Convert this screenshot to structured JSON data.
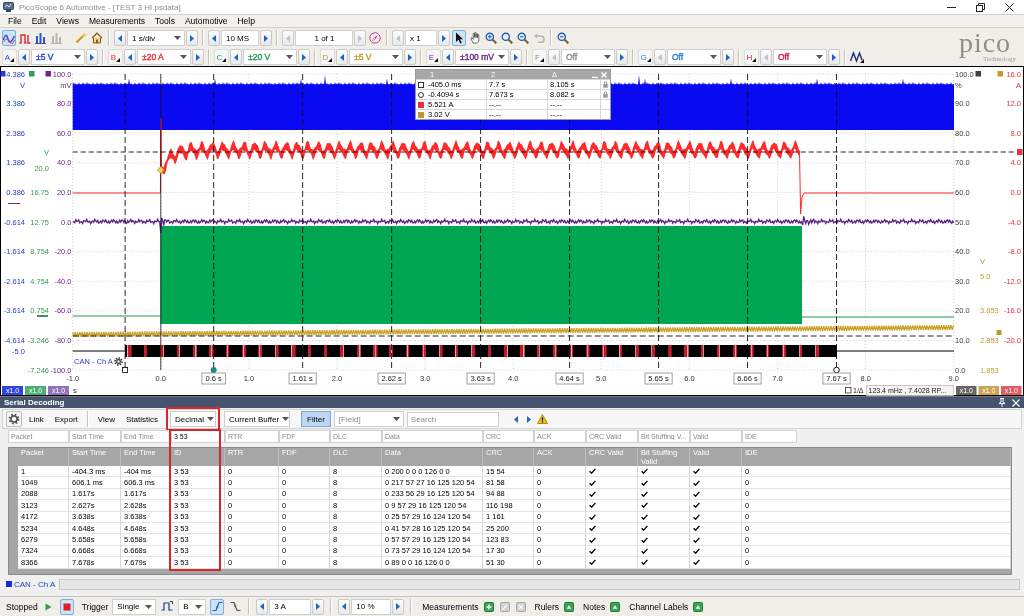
{
  "window": {
    "title": "PicoScope 6 Automotive - [TEST 3 HI.psdata]"
  },
  "menu": [
    "File",
    "Edit",
    "Views",
    "Measurements",
    "Tools",
    "Automotive",
    "Help"
  ],
  "toolbar": {
    "view_modes": [
      {
        "selected": true,
        "disabled": false
      },
      {
        "selected": false,
        "disabled": false
      },
      {
        "selected": false,
        "disabled": false
      },
      {
        "selected": false,
        "disabled": true
      }
    ],
    "timebase": {
      "value": "1 s/div",
      "prev_enabled": true,
      "next_enabled": true
    },
    "samples": {
      "value": "10 MS",
      "prev_enabled": true,
      "next_enabled": true
    },
    "buffer": {
      "value": "1 of 1",
      "prev_enabled": false,
      "next_enabled": false
    },
    "zoom": {
      "value": "x 1",
      "prev_enabled": false,
      "next_enabled": true
    },
    "tools": [
      {
        "selected": true,
        "disabled": false
      },
      {
        "selected": false,
        "disabled": false
      },
      {
        "selected": false,
        "disabled": false
      },
      {
        "selected": false,
        "disabled": false
      },
      {
        "selected": false,
        "disabled": false
      },
      {
        "selected": false,
        "disabled": true
      },
      {
        "selected": false,
        "disabled": false
      }
    ]
  },
  "channels": [
    {
      "letter": "A",
      "range": "±5 V",
      "color": "#2c44d8",
      "enabled": true
    },
    {
      "letter": "B",
      "range": "±20 A",
      "color": "#e8303a",
      "enabled": true
    },
    {
      "letter": "C",
      "range": "±20 V",
      "color": "#2a9a58",
      "enabled": true
    },
    {
      "letter": "D",
      "range": "±5 V",
      "color": "#c09a30",
      "enabled": true
    },
    {
      "letter": "E",
      "range": "±100 mV",
      "color": "#6a2a88",
      "enabled": true
    },
    {
      "letter": "F",
      "range": "Off",
      "color": "#8c8c8c",
      "enabled": false
    },
    {
      "letter": "G",
      "range": "Off",
      "color": "#2c7ee0",
      "enabled": false
    },
    {
      "letter": "H",
      "range": "Off",
      "color": "#c8204a",
      "enabled": false
    }
  ],
  "logo": {
    "name": "pico",
    "tagline": "Technology"
  },
  "scope": {
    "left_axes": [
      {
        "unit": "V",
        "color": "#2c3cd0",
        "ticks": [
          "4.386",
          "3.386",
          "2.386",
          "1.386",
          "0.386",
          "-0.614",
          "-1.614",
          "-2.614",
          "-3.614",
          "-4.614",
          "-5.0"
        ]
      },
      {
        "unit": "V",
        "color": "#3a9a5c",
        "ticks": [
          "20.0",
          "16.75",
          "12.75",
          "8.754",
          "4.754",
          "0.754",
          "-3.246",
          "-7.246"
        ]
      },
      {
        "unit": "mV",
        "color": "#6a2a88",
        "ticks": [
          "100.0",
          "80.0",
          "60.0",
          "40.0",
          "20.0",
          "0.0",
          "-20.0",
          "-40.0",
          "-60.0",
          "-80.0",
          "-100.0"
        ]
      }
    ],
    "right_axes": [
      {
        "unit": "%",
        "color": "#404040",
        "ticks": [
          "100.0",
          "90.0",
          "80.0",
          "70.0",
          "60.0",
          "50.0",
          "40.0",
          "30.0",
          "20.0",
          "10.0",
          "0.0"
        ]
      },
      {
        "unit": "A",
        "color": "#e8303a",
        "ticks": [
          "16.0",
          "12.0",
          "8.0",
          "4.0",
          "0.0",
          "-4.0",
          "-8.0",
          "-12.0",
          "-16.0",
          "-20.0"
        ]
      },
      {
        "unit": "V",
        "color": "#c09a30",
        "ticks": [
          "5.0",
          "3.853",
          "2.853",
          "1.853"
        ]
      }
    ],
    "x_ticks": [
      "-1.0",
      "0.0",
      "1.0",
      "2.0",
      "3.0",
      "4.0",
      "5.0",
      "6.0",
      "7.0",
      "8.0",
      "9.0"
    ],
    "time_unit": "s",
    "rulers": [
      "0.6 s",
      "1.61 s",
      "2.62 s",
      "3.63 s",
      "4.64 s",
      "5.65 s",
      "6.66 s",
      "7.67 s"
    ],
    "decoder_label": "CAN - Ch A",
    "cursor_table": {
      "headers": [
        "1",
        "2",
        "Δ"
      ],
      "rows": [
        {
          "kind": "square",
          "cells": [
            "-405.0 ms",
            "7.7 s",
            "8.105 s"
          ],
          "locked": true
        },
        {
          "kind": "circle",
          "cells": [
            "-0.4094 s",
            "7.673 s",
            "8.082 s"
          ],
          "locked": true
        },
        {
          "kind": "signal",
          "color": "#e8303a",
          "cells": [
            "5.521 A",
            "--.--",
            "--.--"
          ],
          "locked": false
        },
        {
          "kind": "signal",
          "color": "#c09a30",
          "cells": [
            "3.02 V",
            "--.--",
            "--.--"
          ],
          "locked": false
        }
      ]
    },
    "scale_buttons_left": [
      {
        "label": "x1.0",
        "color": "#3344e0"
      },
      {
        "label": "x1.0",
        "color": "#4fae78"
      },
      {
        "label": "x1.0",
        "color": "#9474b8"
      }
    ],
    "scale_buttons_right": [
      {
        "label": "x1.0",
        "color": "#666666"
      },
      {
        "label": "x1.0",
        "color": "#c9a554"
      },
      {
        "label": "x1.0",
        "color": "#e45a66"
      }
    ],
    "readout_toggle": "1/Δ",
    "readout": "123.4 mHz , 7.4028 RP..."
  },
  "serial_decoding": {
    "title": "Serial Decoding",
    "toolbar": {
      "link": "Link",
      "export": "Export",
      "view": "View",
      "statistics": "Statistics",
      "format": {
        "value": "Decimal",
        "highlighted": true
      },
      "buffer": "Current Buffer",
      "filter": {
        "label": "Filter",
        "selected": true
      },
      "field": "[Field]",
      "search": {
        "placeholder": "Search"
      }
    },
    "filters": [
      {
        "placeholder": "Packet"
      },
      {
        "placeholder": "Start Time"
      },
      {
        "placeholder": "End Time"
      },
      {
        "value": "3 53"
      },
      {
        "placeholder": "RTR"
      },
      {
        "placeholder": "FDF"
      },
      {
        "placeholder": "DLC"
      },
      {
        "placeholder": "Data"
      },
      {
        "placeholder": "CRC"
      },
      {
        "placeholder": "ACK"
      },
      {
        "placeholder": "CRC Valid"
      },
      {
        "placeholder": "Bit Stuffing V..."
      },
      {
        "placeholder": "Valid"
      },
      {
        "placeholder": "IDE"
      }
    ],
    "columns": [
      {
        "label": "Packet",
        "kind": "text",
        "highlighted": false
      },
      {
        "label": "Start Time",
        "kind": "text",
        "highlighted": false
      },
      {
        "label": "End Time",
        "kind": "text",
        "highlighted": false
      },
      {
        "label": "ID",
        "kind": "text",
        "highlighted": true
      },
      {
        "label": "RTR",
        "kind": "text",
        "highlighted": false
      },
      {
        "label": "FDF",
        "kind": "text",
        "highlighted": false
      },
      {
        "label": "DLC",
        "kind": "text",
        "highlighted": false
      },
      {
        "label": "Data",
        "kind": "text",
        "highlighted": false
      },
      {
        "label": "CRC",
        "kind": "text",
        "highlighted": false
      },
      {
        "label": "ACK",
        "kind": "text",
        "highlighted": false
      },
      {
        "label": "CRC Valid",
        "kind": "check",
        "highlighted": false
      },
      {
        "label": "Bit Stuffing Valid",
        "kind": "check",
        "highlighted": false
      },
      {
        "label": "Valid",
        "kind": "check",
        "highlighted": false
      },
      {
        "label": "IDE",
        "kind": "text",
        "highlighted": false
      }
    ],
    "rows": [
      [
        "1",
        "-404.3 ms",
        "-404 ms",
        "3 53",
        "0",
        "0",
        "8",
        "0 200 0 0 0 126 0 0",
        "15 54",
        "0",
        true,
        true,
        true,
        "0"
      ],
      [
        "1049",
        "606.1 ms",
        "606.3 ms",
        "3 53",
        "0",
        "0",
        "8",
        "0 217 57 27 16 125 120 54",
        "81 58",
        "0",
        true,
        true,
        true,
        "0"
      ],
      [
        "2088",
        "1.617s",
        "1.617s",
        "3 53",
        "0",
        "0",
        "8",
        "0 233 56 29 16 125 120 54",
        "94 88",
        "0",
        true,
        true,
        true,
        "0"
      ],
      [
        "3123",
        "2.627s",
        "2.628s",
        "3 53",
        "0",
        "0",
        "8",
        "0 9 57 29 16 125 120 54",
        "116 198",
        "0",
        true,
        true,
        true,
        "0"
      ],
      [
        "4172",
        "3.638s",
        "3.638s",
        "3 53",
        "0",
        "0",
        "8",
        "0 25 57 29 16 124 120 54",
        "1 161",
        "0",
        true,
        true,
        true,
        "0"
      ],
      [
        "5234",
        "4.648s",
        "4.648s",
        "3 53",
        "0",
        "0",
        "8",
        "0 41 57 28 16 125 120 54",
        "25 200",
        "0",
        true,
        true,
        true,
        "0"
      ],
      [
        "6279",
        "5.658s",
        "5.658s",
        "3 53",
        "0",
        "0",
        "8",
        "0 57 57 29 16 125 120 54",
        "123 83",
        "0",
        true,
        true,
        true,
        "0"
      ],
      [
        "7324",
        "6.668s",
        "6.668s",
        "3 53",
        "0",
        "0",
        "8",
        "0 73 57 29 16 124 120 54",
        "17 30",
        "0",
        true,
        true,
        true,
        "0"
      ],
      [
        "8366",
        "7.678s",
        "7.679s",
        "3 53",
        "0",
        "0",
        "8",
        "0 89 0 0 16 126 0 0",
        "51 30",
        "0",
        true,
        true,
        true,
        "0"
      ]
    ],
    "tab": "CAN - Ch A"
  },
  "status_bar": {
    "state": "Stopped",
    "running": false,
    "trigger": {
      "label": "Trigger",
      "mode": "Single",
      "channel": "B"
    },
    "edges": [
      {
        "selected": true
      },
      {
        "selected": false
      }
    ],
    "threshold": {
      "value": "3 A",
      "prev_enabled": true,
      "next_enabled": true
    },
    "pre_trigger": {
      "value": "10 %",
      "prev_enabled": true,
      "next_enabled": true
    },
    "panels": [
      {
        "label": "Measurements",
        "buttons": [
          {
            "kind": "add",
            "disabled": false
          },
          {
            "kind": "edit",
            "disabled": true
          },
          {
            "kind": "delete",
            "disabled": true
          }
        ]
      },
      {
        "label": "Rulers",
        "buttons": [
          {
            "kind": "toggle",
            "disabled": false
          }
        ]
      },
      {
        "label": "Notes",
        "buttons": [
          {
            "kind": "toggle",
            "disabled": false
          }
        ]
      },
      {
        "label": "Channel Labels",
        "buttons": [
          {
            "kind": "toggle",
            "disabled": false
          }
        ]
      }
    ]
  }
}
